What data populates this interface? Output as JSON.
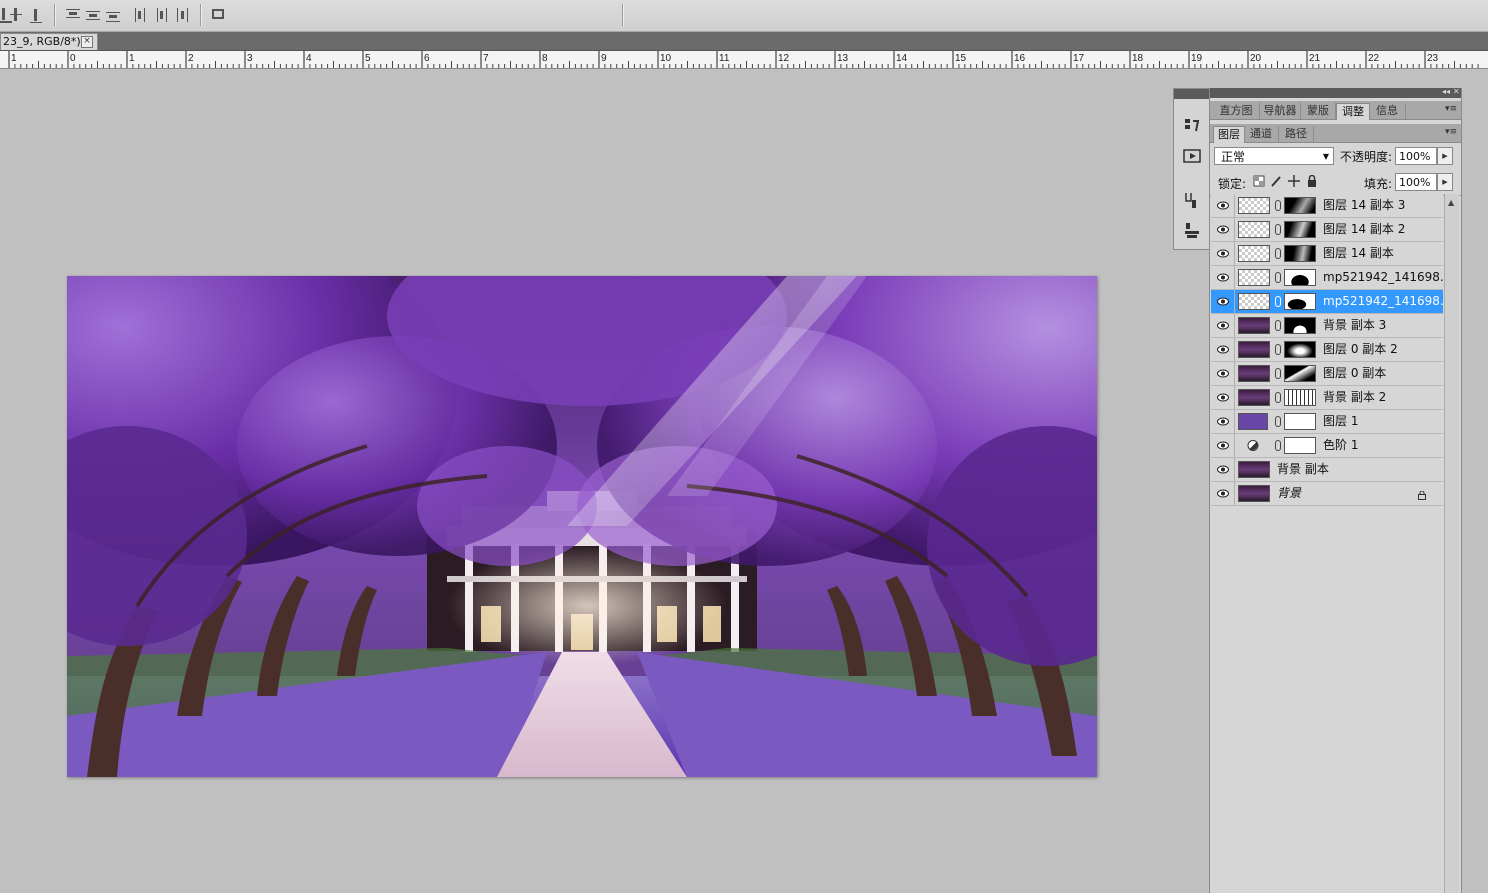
{
  "document_tab": {
    "title": "23_9, RGB/8*)",
    "close_symbol": "×"
  },
  "ruler": {
    "labels": [
      "1",
      "0",
      "1",
      "2",
      "3",
      "4",
      "5",
      "6",
      "7",
      "8",
      "9",
      "10",
      "11",
      "12",
      "13",
      "14",
      "15",
      "16",
      "17",
      "18",
      "19",
      "20",
      "21",
      "22",
      "23"
    ]
  },
  "panel_groups": {
    "top_tabs": [
      "直方图",
      "导航器",
      "蒙版",
      "调整",
      "信息"
    ],
    "top_active": "调整",
    "layer_tabs": [
      "图层",
      "通道",
      "路径"
    ],
    "layer_active": "图层"
  },
  "layers_panel": {
    "blend_mode": "正常",
    "opacity_label": "不透明度:",
    "opacity_value": "100%",
    "lock_label": "锁定:",
    "fill_label": "填充:",
    "fill_value": "100%"
  },
  "layers": [
    {
      "name": "图层 14 副本 3",
      "thumb": "checker",
      "mask": true,
      "selected": false
    },
    {
      "name": "图层 14 副本 2",
      "thumb": "checker",
      "mask": true,
      "selected": false
    },
    {
      "name": "图层 14 副本",
      "thumb": "checker",
      "mask": true,
      "selected": false
    },
    {
      "name": "mp521942_141698...",
      "thumb": "checker",
      "mask": true,
      "selected": false
    },
    {
      "name": "mp521942_141698...",
      "thumb": "checker",
      "mask": true,
      "selected": true
    },
    {
      "name": "背景 副本 3",
      "thumb": "photo",
      "mask": true,
      "selected": false
    },
    {
      "name": "图层 0 副本 2",
      "thumb": "photo",
      "mask": true,
      "selected": false
    },
    {
      "name": "图层 0 副本",
      "thumb": "photo",
      "mask": true,
      "selected": false
    },
    {
      "name": "背景 副本 2",
      "thumb": "photo",
      "mask": true,
      "selected": false
    },
    {
      "name": "图层 1",
      "thumb": "purple",
      "mask": true,
      "selected": false
    },
    {
      "name": "色阶 1",
      "thumb": "adjust",
      "mask": true,
      "selected": false
    },
    {
      "name": "背景 副本",
      "thumb": "photo",
      "mask": false,
      "selected": false
    },
    {
      "name": "背景",
      "thumb": "photo",
      "mask": false,
      "selected": false,
      "locked": true,
      "italic": true
    }
  ],
  "colors": {
    "selection": "#3399ff",
    "canvas_bg": "#c0c0c0",
    "accent_purple": "#6a46a8"
  }
}
